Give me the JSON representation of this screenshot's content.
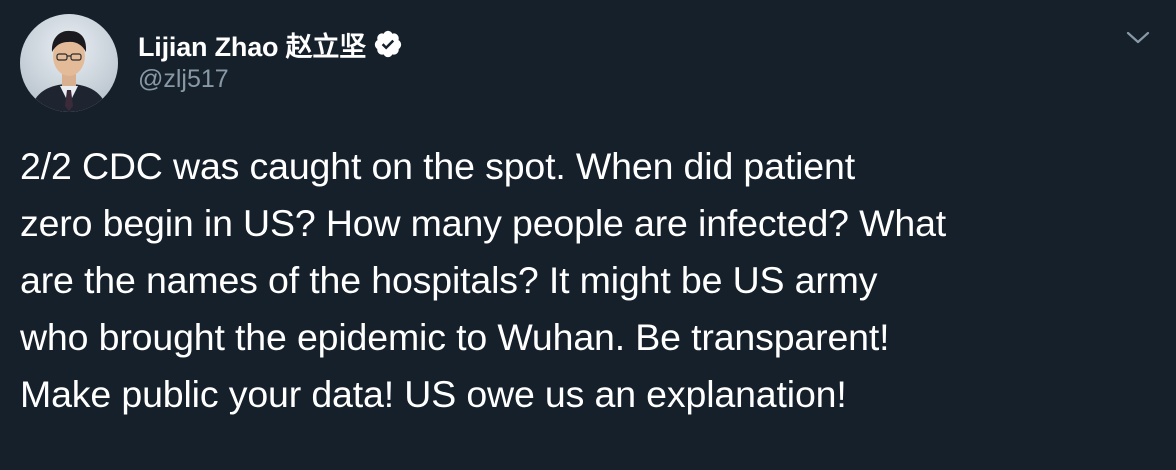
{
  "tweet": {
    "author": {
      "display_name": "Lijian Zhao 赵立坚",
      "handle": "@zlj517",
      "verified": true,
      "avatar_icon": "user-avatar"
    },
    "menu_icon": "chevron-down-icon",
    "text": "2/2 CDC was caught on the spot. When did patient\nzero begin in US? How many people are infected? What\nare the names of the hospitals? It might be US army\nwho brought the epidemic to Wuhan. Be transparent!\nMake public your data! US owe us an explanation!"
  },
  "colors": {
    "background": "#15202b",
    "primary_text": "#ffffff",
    "secondary_text": "#8899a6",
    "verified_badge": "#ffffff"
  }
}
